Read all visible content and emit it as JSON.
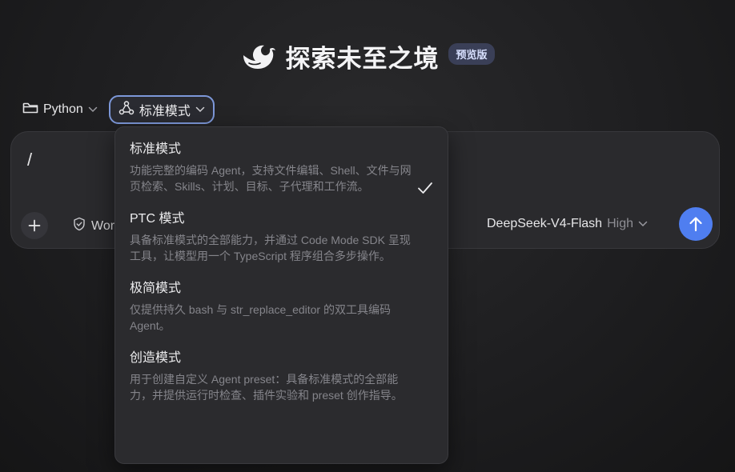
{
  "header": {
    "logo_icon": "whale-logo-icon",
    "title": "探索未至之境",
    "badge": "预览版"
  },
  "toolbar": {
    "language_label": "Python",
    "mode_label": "标准模式"
  },
  "input": {
    "value": "/",
    "chip_label": "Wor"
  },
  "model": {
    "name": "DeepSeek-V4-Flash",
    "effort": "High"
  },
  "dropdown": {
    "selected_index": 0,
    "options": [
      {
        "title": "标准模式",
        "description": "功能完整的编码 Agent，支持文件编辑、Shell、文件与网页检索、Skills、计划、目标、子代理和工作流。"
      },
      {
        "title": "PTC 模式",
        "description": "具备标准模式的全部能力，并通过 Code Mode SDK 呈现工具，让模型用一个 TypeScript 程序组合多步操作。"
      },
      {
        "title": "极简模式",
        "description": "仅提供持久 bash 与 str_replace_editor 的双工具编码 Agent。"
      },
      {
        "title": "创造模式",
        "description": "用于创建自定义 Agent preset：具备标准模式的全部能力，并提供运行时检查、插件实验和 preset 创作指导。"
      }
    ]
  },
  "colors": {
    "accent": "#4f7ef0",
    "mode_border": "#7d98d9",
    "badge_bg": "#3a3f57"
  }
}
